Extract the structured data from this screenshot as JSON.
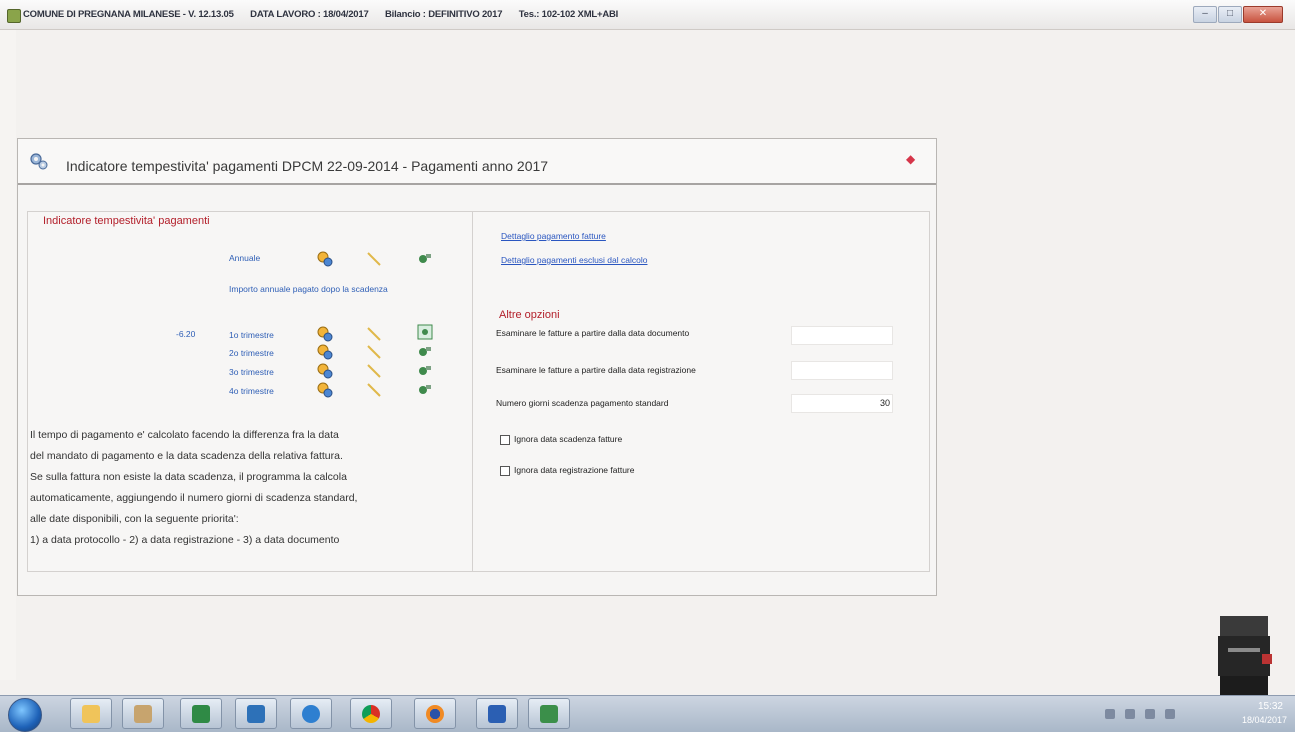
{
  "window": {
    "title_parts": [
      "COMUNE DI PREGNANA MILANESE - V. 12.13.05",
      "DATA LAVORO : 18/04/2017",
      "Bilancio : DEFINITIVO 2017",
      "Tes.: 102-102 XML+ABI"
    ],
    "buttons": {
      "minimize": "–",
      "maximize": "□",
      "close": "✕"
    }
  },
  "dialog": {
    "title": "Indicatore tempestivita' pagamenti DPCM 22-09-2014 - Pagamenti anno  2017",
    "left": {
      "section_title": "Indicatore tempestivita' pagamenti",
      "annual_label": "Annuale",
      "annual_amount_label": "Importo annuale pagato dopo la scadenza",
      "quarters": [
        {
          "value": "-6.20",
          "label": "1o trimestre"
        },
        {
          "value": "",
          "label": "2o trimestre"
        },
        {
          "value": "",
          "label": "3o trimestre"
        },
        {
          "value": "",
          "label": "4o trimestre"
        }
      ],
      "notes": [
        "Il tempo di pagamento e' calcolato facendo la differenza fra la data",
        "del mandato di pagamento e la data scadenza della relativa fattura.",
        "Se sulla fattura non esiste la data scadenza, il programma la calcola",
        "automaticamente, aggiungendo il numero giorni di scadenza standard,",
        "alle date disponibili, con la seguente priorita':",
        "1) a data protocollo - 2) a data registrazione - 3) a data documento"
      ]
    },
    "right": {
      "links": [
        "Dettaglio pagamento fatture",
        "Dettaglio pagamenti esclusi dal calcolo"
      ],
      "options_title": "Altre opzioni",
      "fields": [
        {
          "label": "Esaminare le fatture a partire dalla data documento",
          "value": ""
        },
        {
          "label": "Esaminare le fatture a partire dalla data registrazione",
          "value": ""
        },
        {
          "label": "Numero giorni scadenza pagamento standard",
          "value": "30"
        }
      ],
      "checkboxes": [
        {
          "label": "Ignora data scadenza fatture",
          "checked": false
        },
        {
          "label": "Ignora data registrazione fatture",
          "checked": false
        }
      ]
    }
  },
  "taskbar": {
    "apps": [
      "explorer",
      "photo",
      "excel",
      "publisher",
      "internet-explorer",
      "chrome",
      "firefox",
      "word",
      "app"
    ],
    "clock_time": "15:32",
    "clock_date": "18/04/2017"
  }
}
